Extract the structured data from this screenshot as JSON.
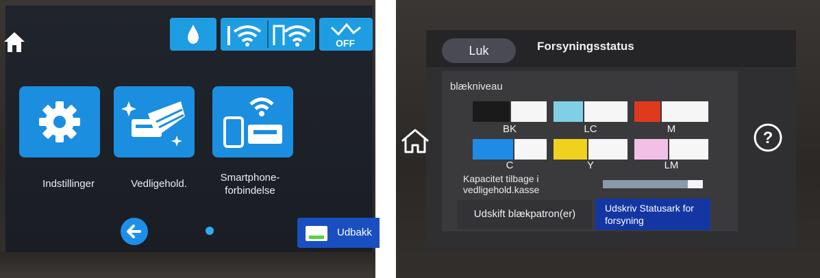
{
  "left_screen": {
    "tiles": [
      {
        "label": "Indstillinger",
        "icon": "gear-icon"
      },
      {
        "label": "Vedligehold.",
        "icon": "maintenance-icon"
      },
      {
        "label": "Smartphone-\nforbindelse",
        "icon": "smartphone-printer-icon"
      }
    ],
    "status_icons": [
      "ink-drop-icon",
      "wifi-printer-icon",
      "wifi-direct-icon",
      "wifi-off-icon"
    ],
    "tray_button_label": "Udbakk",
    "accent": "#1e9de3"
  },
  "right_screen": {
    "close_label": "Luk",
    "title": "Forsyningsstatus",
    "ink_section_label": "blækniveau",
    "inks": [
      {
        "name": "BK",
        "color": "#1a1a1a",
        "level": 0.5
      },
      {
        "name": "LC",
        "color": "#7fd0e6",
        "level": 0.4
      },
      {
        "name": "M",
        "color": "#e03a1e",
        "level": 0.35
      },
      {
        "name": "C",
        "color": "#1e8ce6",
        "level": 0.55
      },
      {
        "name": "Y",
        "color": "#f0d21e",
        "level": 0.45
      },
      {
        "name": "LM",
        "color": "#f2c0e6",
        "level": 0.45
      }
    ],
    "maintenance_box_label": "Kapacitet tilbage i\nvedligehold.kasse",
    "maintenance_box_level": 0.85,
    "replace_button_label": "Udskift blækpatron(er)",
    "print_button_label": "Udskriv Statusark for\nforsyning"
  }
}
